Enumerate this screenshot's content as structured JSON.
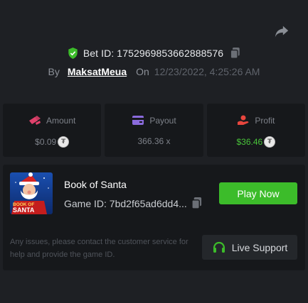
{
  "header": {
    "share_icon": "share-arrow-icon",
    "bet_id_label": "Bet ID: 1752969853662888576",
    "by_label": "By",
    "username": "MaksatMeua",
    "on_label": "On",
    "date": "12/23/2022, 4:25:26 AM"
  },
  "stats": {
    "amount": {
      "label": "Amount",
      "value": "$0.09",
      "icon": "coin-stack-icon",
      "color": "#e0416b"
    },
    "payout": {
      "label": "Payout",
      "value": "366.36 x",
      "icon": "wallet-icon",
      "color": "#8a6bdc"
    },
    "profit": {
      "label": "Profit",
      "value": "$36.46",
      "icon": "hand-coin-icon",
      "color": "#e8463e"
    }
  },
  "game": {
    "title": "Book of Santa",
    "game_id_label": "Game ID: 7bd2f65ad6dd4...",
    "thumbnail_text_1": "BOOK OF",
    "thumbnail_text_2": "SANTA",
    "play_label": "Play Now",
    "note": "Any issues, please contact the customer service for help and provide the game ID.",
    "support_label": "Live Support"
  },
  "colors": {
    "accent_green": "#3cbc2a",
    "profit_green": "#49c33a",
    "background": "#1e2024",
    "card": "#16181b"
  }
}
